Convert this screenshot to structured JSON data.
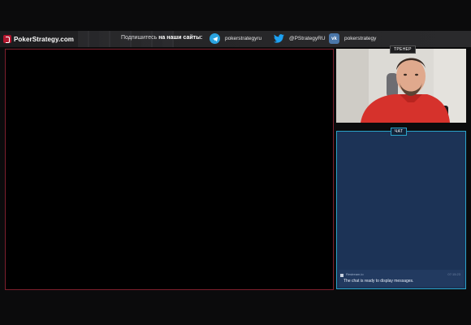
{
  "header": {
    "logo_text": "PokerStrategy.com",
    "subscribe_text": "Подпишитесь",
    "subscribe_bold": "на наши сайты:",
    "socials": [
      {
        "icon": "telegram-icon",
        "label": "pokerstrategyru"
      },
      {
        "icon": "twitter-icon",
        "label": "@PStrategyRU"
      },
      {
        "icon": "vk-icon",
        "label": "pokerstrategy"
      }
    ]
  },
  "panels": {
    "trainer_label": "ТРЕНЕР",
    "chat_label": "ЧАТ"
  },
  "chat": {
    "messages": [
      {
        "user": "Restream.io",
        "time": "07:15:23",
        "text": "The chat is ready to display messages."
      }
    ]
  },
  "colors": {
    "brand_red": "#b3172f",
    "video_border": "#7d1f2c",
    "chat_border": "#2aa3c9",
    "chat_bg": "#1c3356",
    "telegram": "#2aa3df",
    "twitter": "#1da1f2",
    "vk": "#4a76a8"
  }
}
